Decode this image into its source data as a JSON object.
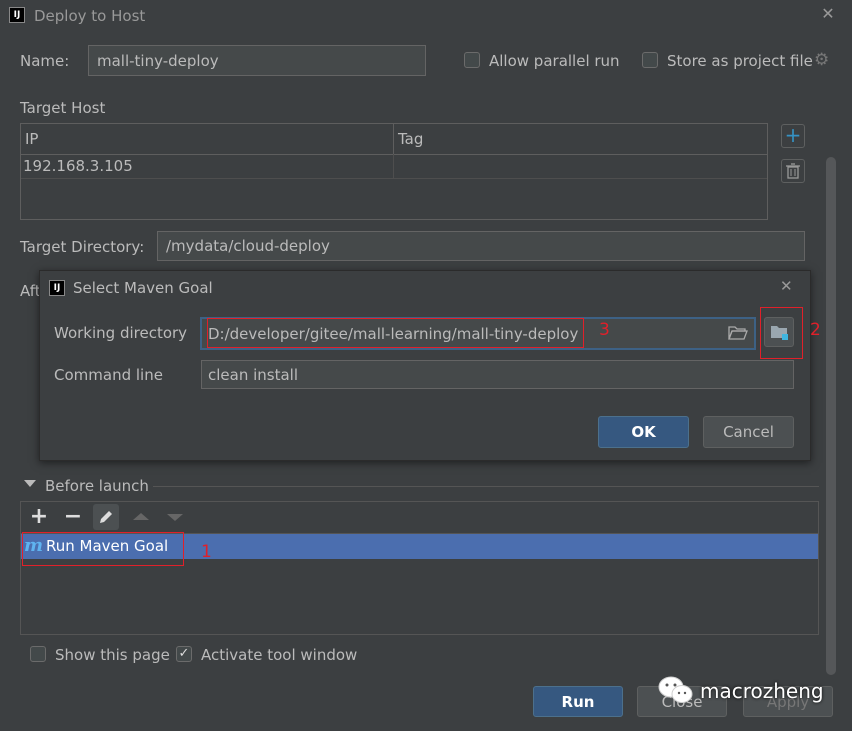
{
  "window": {
    "title": "Deploy to Host"
  },
  "header": {
    "name_label": "Name:",
    "name_value": "mall-tiny-deploy",
    "allow_parallel_label": "Allow parallel run",
    "allow_parallel_checked": false,
    "store_project_label": "Store as project file",
    "store_project_checked": false
  },
  "target_host": {
    "label": "Target Host",
    "columns": [
      "IP",
      "Tag"
    ],
    "rows": [
      {
        "ip": "192.168.3.105",
        "tag": ""
      }
    ]
  },
  "target_directory": {
    "label": "Target Directory:",
    "value": "/mydata/cloud-deploy"
  },
  "after_label_partial": "Aft",
  "maven_dialog": {
    "title": "Select Maven Goal",
    "working_dir_label": "Working directory",
    "working_dir_value": "D:/developer/gitee/mall-learning/mall-tiny-deploy",
    "command_line_label": "Command line",
    "command_line_value": "clean install",
    "ok_label": "OK",
    "cancel_label": "Cancel"
  },
  "before_launch": {
    "label": "Before launch",
    "items": [
      {
        "label": "Run Maven Goal",
        "icon": "m",
        "selected": true
      }
    ]
  },
  "footer": {
    "show_page_label": "Show this page",
    "show_page_checked": false,
    "activate_tool_label": "Activate tool window",
    "activate_tool_checked": true,
    "run_label": "Run",
    "close_label": "Close",
    "apply_label": "Apply"
  },
  "annotations": {
    "one": "1",
    "two": "2",
    "three": "3"
  },
  "watermark": "macrozheng",
  "colors": {
    "background": "#3c3f41",
    "accent": "#365880",
    "selection": "#4b6eaf",
    "annotation": "#e0202a"
  }
}
